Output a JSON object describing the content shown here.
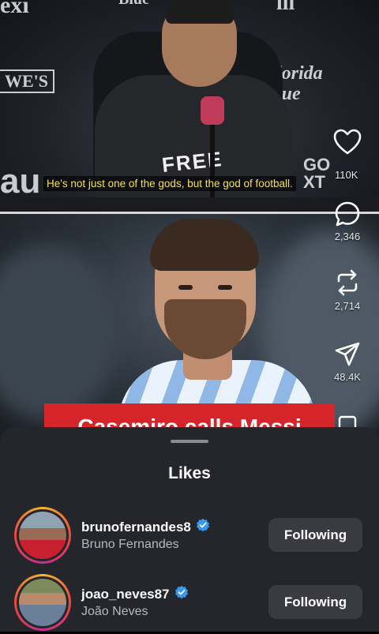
{
  "video": {
    "subtitle": "He's not just one of the gods, but the god of football.",
    "title_banner": "Casemiro calls Messi",
    "backdrop": {
      "top_left": "exi",
      "sponsor_left": "WE'S",
      "left_partial": "au",
      "sponsor_right": "lorida\nlue",
      "sponsor_right_bottom": "GO\nXT",
      "top_mid": "Blue",
      "top_right": "lll"
    },
    "shirt_print": "FREE"
  },
  "actions": {
    "likes": "110K",
    "comments": "2,346",
    "reposts": "2,714",
    "shares": "48.4K"
  },
  "likes_sheet": {
    "title": "Likes",
    "users": [
      {
        "username": "brunofernandes8",
        "full_name": "Bruno Fernandes",
        "button": "Following",
        "verified": true
      },
      {
        "username": "joao_neves87",
        "full_name": "João Neves",
        "button": "Following",
        "verified": true
      }
    ]
  },
  "colors": {
    "subtitle": "#f3e24a",
    "banner": "#d6242b",
    "sheet_bg": "#25262b",
    "verified": "#3897f0"
  }
}
